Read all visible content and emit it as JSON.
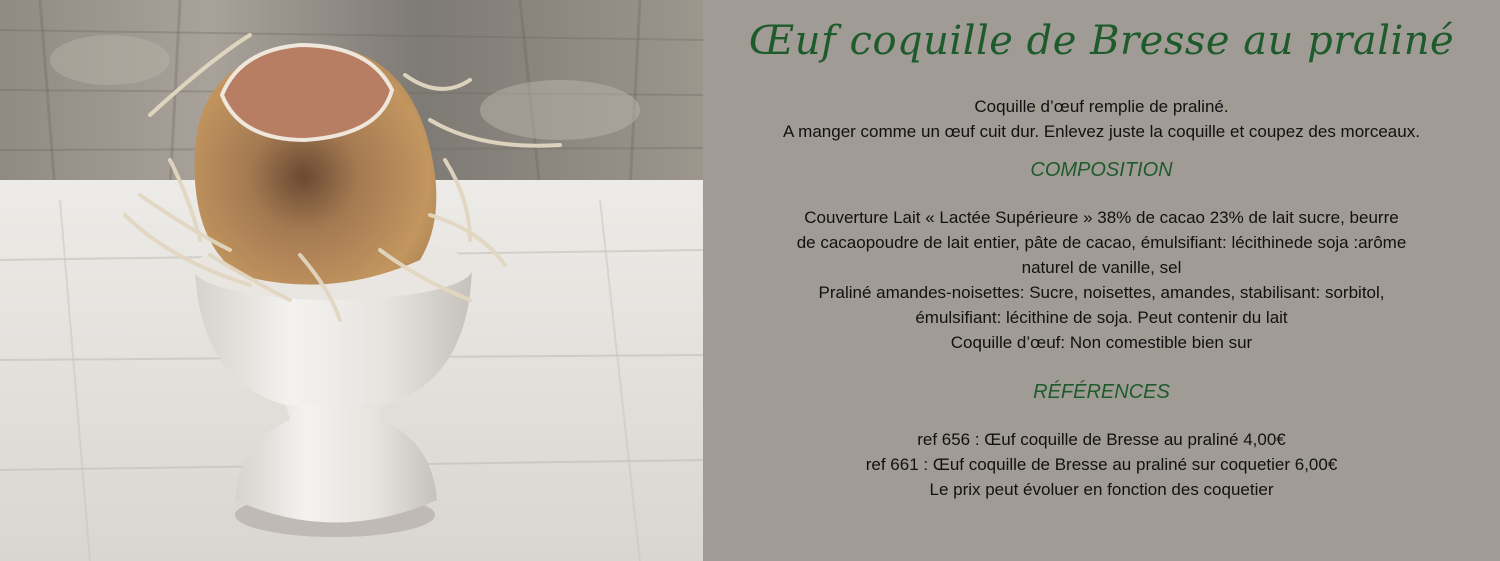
{
  "title": "Œuf coquille de Bresse au praliné",
  "intro": [
    "Coquille d’œuf remplie de praliné.",
    "A manger comme un œuf cuit dur. Enlevez juste la coquille et coupez des morceaux."
  ],
  "composition": {
    "heading": "COMPOSITION",
    "lines": [
      "Couverture Lait « Lactée Supérieure » 38% de cacao 23% de lait sucre, beurre",
      "de cacaopoudre de lait entier, pâte de cacao, émulsifiant: lécithinede soja :arôme",
      "naturel de vanille, sel",
      "Praliné amandes-noisettes: Sucre, noisettes, amandes, stabilisant: sorbitol,",
      "émulsifiant: lécithine de soja. Peut contenir du lait",
      "Coquille d’œuf: Non comestible bien sur"
    ]
  },
  "references": {
    "heading": "RÉFÉRENCES",
    "lines": [
      "ref 656 : Œuf coquille de Bresse au praliné 4,00€",
      "ref 661 : Œuf coquille de Bresse au praliné sur coquetier 6,00€",
      "Le prix peut évoluer en fonction des coquetier"
    ]
  },
  "colors": {
    "panel_background": "#a19b95",
    "heading_green": "#1e5b2c",
    "body_text": "#111111"
  }
}
